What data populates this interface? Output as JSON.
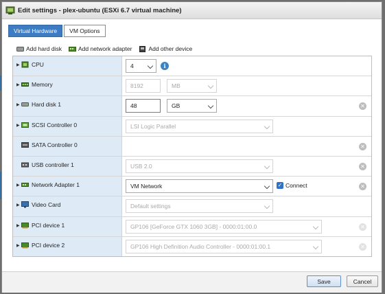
{
  "window": {
    "title": "Edit settings - plex-ubuntu (ESXi 6.7 virtual machine)"
  },
  "tabs": [
    {
      "label": "Virtual Hardware",
      "active": true
    },
    {
      "label": "VM Options",
      "active": false
    }
  ],
  "toolbar": {
    "add_hard_disk": "Add hard disk",
    "add_network_adapter": "Add network adapter",
    "add_other_device": "Add other device"
  },
  "devices": {
    "cpu": {
      "label": "CPU",
      "value": "4",
      "icon": "cpu-icon"
    },
    "memory": {
      "label": "Memory",
      "value": "8192",
      "unit": "MB",
      "icon": "memory-icon"
    },
    "hard_disk_1": {
      "label": "Hard disk 1",
      "value": "48",
      "unit": "GB",
      "icon": "hard-disk-icon"
    },
    "scsi_controller_0": {
      "label": "SCSI Controller 0",
      "value": "LSI Logic Parallel",
      "icon": "scsi-icon"
    },
    "sata_controller_0": {
      "label": "SATA Controller 0",
      "icon": "sata-icon"
    },
    "usb_controller_1": {
      "label": "USB controller 1",
      "value": "USB 2.0",
      "icon": "usb-icon"
    },
    "network_adapter_1": {
      "label": "Network Adapter 1",
      "value": "VM Network",
      "connect_label": "Connect",
      "connected": true,
      "icon": "network-icon"
    },
    "video_card": {
      "label": "Video Card",
      "value": "Default settings",
      "icon": "monitor-icon"
    },
    "pci_device_1": {
      "label": "PCI device 1",
      "value": "GP106 [GeForce GTX 1060 3GB] - 0000:01:00.0",
      "icon": "pci-icon"
    },
    "pci_device_2": {
      "label": "PCI device 2",
      "value": "GP106 High Definition Audio Controller - 0000:01:00.1",
      "icon": "pci-icon"
    }
  },
  "footer": {
    "save_label": "Save",
    "cancel_label": "Cancel"
  },
  "colors": {
    "accent": "#3d7cc3",
    "label_column": "#deebf6",
    "title_bar": "#e6e6e6"
  }
}
